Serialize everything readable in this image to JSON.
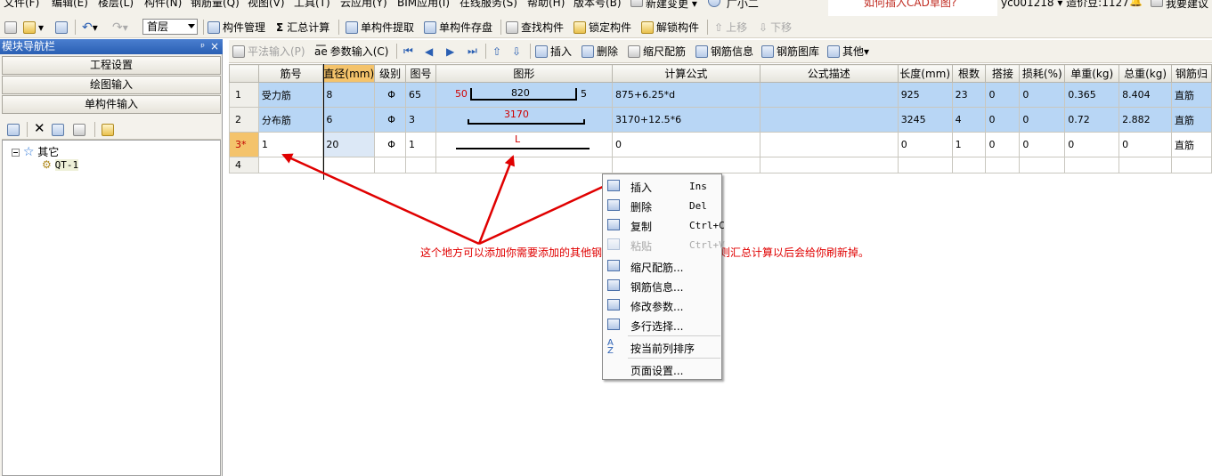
{
  "menubar": {
    "items": [
      "文件(F)",
      "编辑(E)",
      "楼层(L)",
      "构件(N)",
      "钢筋量(Q)",
      "视图(V)",
      "工具(T)",
      "云应用(Y)",
      "BIM应用(I)",
      "在线服务(S)",
      "帮助(H)",
      "版本号(B)"
    ],
    "new_change": "新建变更",
    "user_extra": "广小二",
    "question": "如何插入CAD草图?",
    "user": "yc001218",
    "price_bean": "造价豆:1127",
    "suggest": "我要建议"
  },
  "toolbar1": {
    "floor": "首层",
    "component_mgmt": "构件管理",
    "sum_calc": "汇总计算",
    "single_extract": "单构件提取",
    "single_save": "单构件存盘",
    "find": "查找构件",
    "lock": "锁定构件",
    "unlock": "解锁构件",
    "move_up": "上移",
    "move_down": "下移"
  },
  "nav": {
    "title": "模块导航栏",
    "pin": "ᵖ",
    "close": "×",
    "buttons": [
      "工程设置",
      "绘图输入",
      "单构件输入"
    ],
    "tree_root": "其它",
    "tree_child": "QT-1"
  },
  "toolbar2": {
    "flat_input": "平法输入(P)",
    "param_input": "参数输入(C)",
    "insert": "插入",
    "delete": "删除",
    "scale_rebar": "缩尺配筋",
    "rebar_info": "钢筋信息",
    "rebar_lib": "钢筋图库",
    "other": "其他"
  },
  "grid": {
    "headers": [
      "筋号",
      "直径(mm)",
      "级别",
      "图号",
      "图形",
      "计算公式",
      "公式描述",
      "长度(mm)",
      "根数",
      "搭接",
      "损耗(%)",
      "单重(kg)",
      "总重(kg)",
      "钢筋归"
    ],
    "rows": [
      {
        "no": "1",
        "name": "受力筋",
        "dia": "8",
        "grade": "Φ",
        "fig": "65",
        "shape_left": "50",
        "shape_mid": "820",
        "shape_right": "5",
        "formula": "875+6.25*d",
        "desc": "",
        "length": "925",
        "count": "23",
        "lap": "0",
        "loss": "0",
        "unit_w": "0.365",
        "total_w": "8.404",
        "type": "直筋"
      },
      {
        "no": "2",
        "name": "分布筋",
        "dia": "6",
        "grade": "Φ",
        "fig": "3",
        "shape_mid": "3170",
        "formula": "3170+12.5*6",
        "desc": "",
        "length": "3245",
        "count": "4",
        "lap": "0",
        "loss": "0",
        "unit_w": "0.72",
        "total_w": "2.882",
        "type": "直筋"
      },
      {
        "no": "3*",
        "name": "1",
        "dia": "20",
        "grade": "Φ",
        "fig": "1",
        "shape_mid": "L",
        "formula": "0",
        "desc": "",
        "length": "0",
        "count": "1",
        "lap": "0",
        "loss": "0",
        "unit_w": "0",
        "total_w": "0",
        "type": "直筋"
      },
      {
        "no": "4"
      }
    ]
  },
  "context_menu": {
    "items": [
      {
        "label": "插入",
        "shortcut": "Ins"
      },
      {
        "label": "删除",
        "shortcut": "Del"
      },
      {
        "label": "复制",
        "shortcut": "Ctrl+C"
      },
      {
        "label": "粘贴",
        "shortcut": "Ctrl+V"
      },
      {
        "label": "缩尺配筋..."
      },
      {
        "label": "钢筋信息..."
      },
      {
        "label": "修改参数..."
      },
      {
        "label": "多行选择..."
      },
      {
        "label": "按当前列排序"
      },
      {
        "label": "页面设置..."
      }
    ]
  },
  "annotation": "这个地方可以添加你需要添加的其他钢筋，添加完成后锁定，否则汇总计算以后会给你刷新掉。",
  "colors": {
    "accent": "#2a5fb3",
    "selected_row": "#b8d6f5",
    "annotation": "#e00000",
    "header_highlight": "#f4c36b"
  }
}
